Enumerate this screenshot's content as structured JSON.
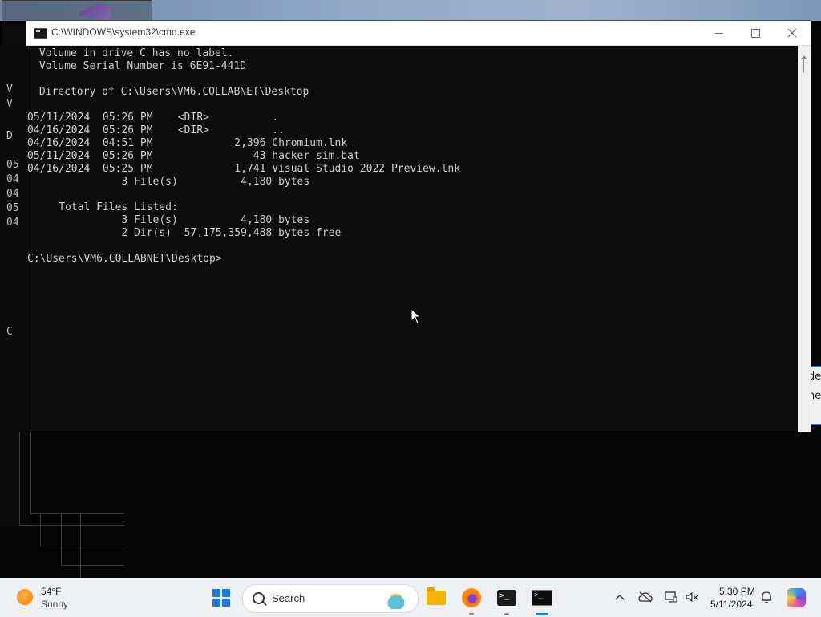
{
  "window": {
    "title": "C:\\WINDOWS\\system32\\cmd.exe"
  },
  "console": {
    "lines": [
      " Volume in drive C has no label.",
      " Volume Serial Number is 6E91-441D",
      "",
      " Directory of C:\\Users\\VM6.COLLABNET\\Desktop",
      "",
      "05/11/2024  05:26 PM    <DIR>          .",
      "04/16/2024  05:26 PM    <DIR>          ..",
      "04/16/2024  04:51 PM             2,396 Chromium.lnk",
      "05/11/2024  05:26 PM                43 hacker sim.bat",
      "04/16/2024  05:25 PM             1,741 Visual Studio 2022 Preview.lnk",
      "               3 File(s)          4,180 bytes",
      "",
      "     Total Files Listed:",
      "               3 File(s)          4,180 bytes",
      "               2 Dir(s)  57,175,359,488 bytes free",
      "",
      "C:\\Users\\VM6.COLLABNET\\Desktop>"
    ]
  },
  "background_window": {
    "fragments": [
      "V",
      "V",
      "D",
      "05",
      "04",
      "04",
      "05",
      "04",
      "C"
    ]
  },
  "right_panel": {
    "fragments": [
      "de",
      "ne"
    ]
  },
  "taskbar": {
    "weather_temp": "54°F",
    "weather_condition": "Sunny",
    "search_label": "Search",
    "clock_time": "5:30 PM",
    "clock_date": "5/11/2024"
  },
  "icons": {
    "start": "windows-start-icon",
    "explorer": "folder-icon",
    "browser": "firefox-icon",
    "terminal": "terminal-icon",
    "cmd": "cmd-icon"
  },
  "colors": {
    "console_bg": "#0c0c0c",
    "console_text": "#cccccc",
    "accent": "#1f7ae0"
  }
}
